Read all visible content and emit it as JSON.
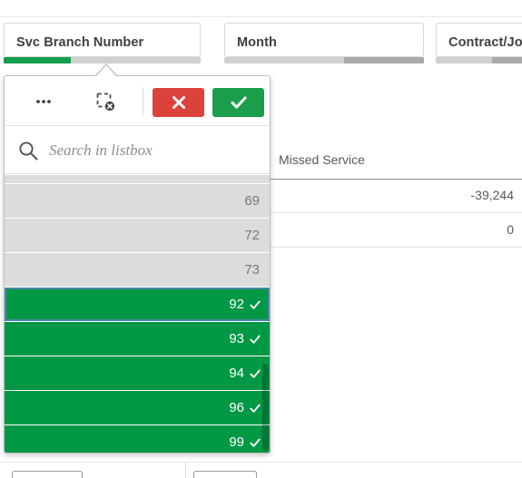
{
  "filters": [
    {
      "id": "svc-branch-number",
      "title": "Svc Branch Number",
      "bar_fill_pct": 34,
      "bar_color": "#159e4e"
    },
    {
      "id": "month",
      "title": "Month",
      "bar_fill_pct": 0,
      "thumb_pct": 40,
      "bar_color": "#aaaaaa"
    },
    {
      "id": "contract-job",
      "title": "Contract/Job",
      "bar_fill_pct": 0,
      "thumb_pct": 45,
      "bar_color": "#aaaaaa"
    }
  ],
  "table": {
    "column_header": "Missed Service",
    "rows": [
      {
        "value": "-39,244"
      },
      {
        "value": "0"
      }
    ]
  },
  "listbox": {
    "toolbar": {
      "menu_label": "•••",
      "menu_name": "more-options",
      "clear_label": "Clear selection",
      "cancel_label": "Cancel",
      "confirm_label": "Confirm"
    },
    "search": {
      "placeholder": "Search in listbox",
      "value": ""
    },
    "items": [
      {
        "value": "",
        "state": "excluded",
        "partial": true
      },
      {
        "value": "69",
        "state": "excluded"
      },
      {
        "value": "72",
        "state": "excluded"
      },
      {
        "value": "73",
        "state": "excluded"
      },
      {
        "value": "92",
        "state": "selected",
        "focused": true
      },
      {
        "value": "93",
        "state": "selected"
      },
      {
        "value": "94",
        "state": "selected"
      },
      {
        "value": "96",
        "state": "selected"
      },
      {
        "value": "99",
        "state": "selected"
      }
    ],
    "check_glyph": "✔"
  },
  "colors": {
    "selected_green": "#009845",
    "excluded_gray": "#dcdcdc",
    "confirm_green": "#1a9e4b",
    "cancel_red": "#dc423c",
    "focus_blue": "#4a87a8"
  }
}
